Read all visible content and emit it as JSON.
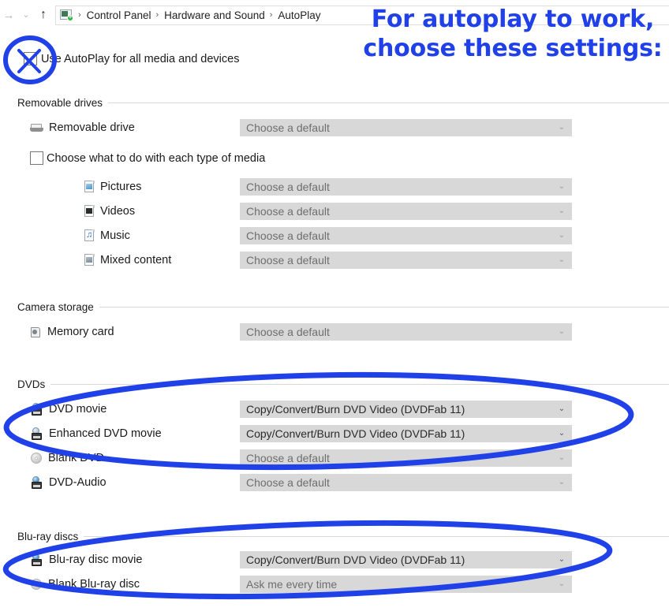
{
  "window": {
    "breadcrumb": {
      "icon": "control-panel-icon",
      "separator": "›",
      "items": [
        "Control Panel",
        "Hardware and Sound",
        "AutoPlay"
      ]
    },
    "nav": {
      "back_icon": "→",
      "recent_icon": "⌄",
      "up_icon": "↑"
    }
  },
  "annotations": {
    "headline_line1": "For autoplay to work,",
    "headline_line2": "choose these settings:",
    "ink_color": "#2040e8",
    "marks": [
      {
        "name": "circle-use-autoplay-checkbox",
        "shape": "circle"
      },
      {
        "name": "x-mark-over-checkbox",
        "shape": "x"
      },
      {
        "name": "ellipse-dvd-rows",
        "shape": "ellipse"
      },
      {
        "name": "ellipse-bluray-rows",
        "shape": "ellipse"
      }
    ]
  },
  "master_toggle": {
    "label": "Use AutoPlay for all media and devices",
    "checked": false
  },
  "combo_arrow": "⌄",
  "sections": [
    {
      "id": "removable-drives",
      "title": "Removable drives",
      "rows": [
        {
          "label": "Removable drive",
          "icon": "removable-drive-icon",
          "value": "Choose a default",
          "disabled": true,
          "indent": "a"
        }
      ],
      "checkbox": {
        "label": "Choose what to do with each type of media",
        "checked": false
      },
      "media_rows": [
        {
          "label": "Pictures",
          "icon": "pictures-icon",
          "value": "Choose a default",
          "disabled": true,
          "indent": "b"
        },
        {
          "label": "Videos",
          "icon": "videos-icon",
          "value": "Choose a default",
          "disabled": true,
          "indent": "b"
        },
        {
          "label": "Music",
          "icon": "music-icon",
          "value": "Choose a default",
          "disabled": true,
          "indent": "b"
        },
        {
          "label": "Mixed content",
          "icon": "mixed-content-icon",
          "value": "Choose a default",
          "disabled": true,
          "indent": "b"
        }
      ]
    },
    {
      "id": "camera-storage",
      "title": "Camera storage",
      "rows": [
        {
          "label": "Memory card",
          "icon": "memory-card-icon",
          "value": "Choose a default",
          "disabled": true,
          "indent": "a"
        }
      ]
    },
    {
      "id": "dvds",
      "title": "DVDs",
      "rows": [
        {
          "label": "DVD movie",
          "icon": "dvd-drive-icon",
          "value": "Copy/Convert/Burn DVD Video (DVDFab 11)",
          "disabled": false,
          "indent": "a"
        },
        {
          "label": "Enhanced DVD movie",
          "icon": "enhanced-dvd-drive-icon",
          "value": "Copy/Convert/Burn DVD Video (DVDFab 11)",
          "disabled": false,
          "indent": "a"
        },
        {
          "label": "Blank DVD",
          "icon": "blank-disc-icon",
          "value": "Choose a default",
          "disabled": true,
          "indent": "a"
        },
        {
          "label": "DVD-Audio",
          "icon": "dvd-drive-icon",
          "value": "Choose a default",
          "disabled": true,
          "indent": "a"
        }
      ]
    },
    {
      "id": "blu-ray-discs",
      "title": "Blu-ray discs",
      "rows": [
        {
          "label": "Blu-ray disc movie",
          "icon": "dvd-drive-icon",
          "value": "Copy/Convert/Burn DVD Video (DVDFab 11)",
          "disabled": false,
          "indent": "a"
        },
        {
          "label": "Blank Blu-ray disc",
          "icon": "blank-disc-icon",
          "value": "Ask me every time",
          "disabled": true,
          "indent": "a"
        }
      ]
    }
  ]
}
